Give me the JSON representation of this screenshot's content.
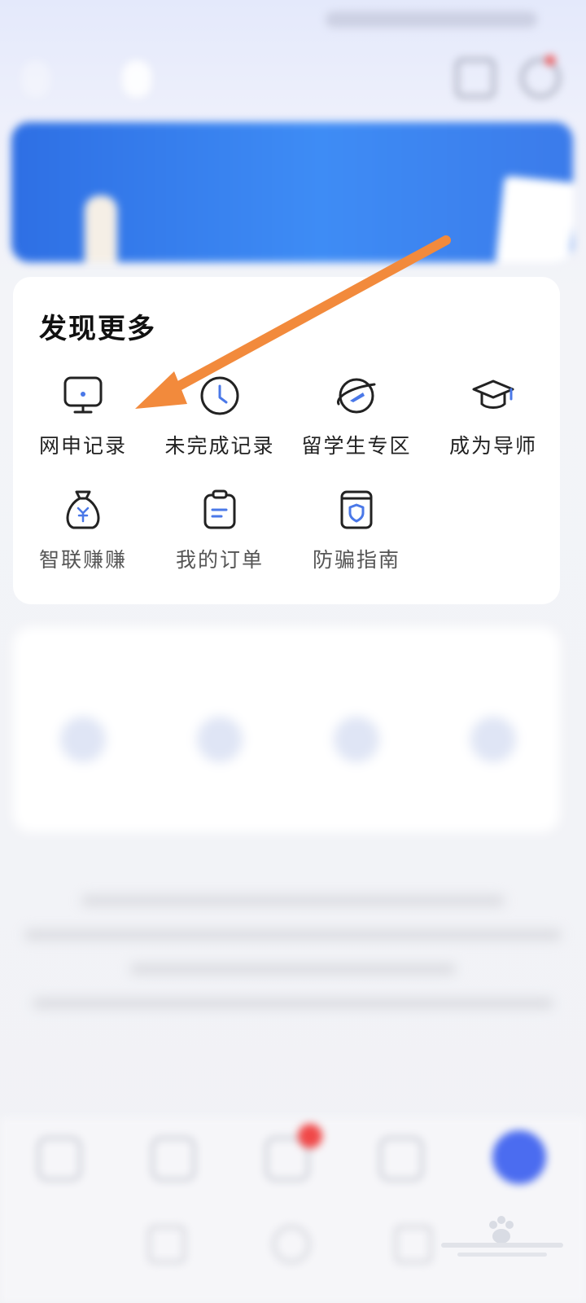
{
  "discover": {
    "title": "发现更多",
    "items": [
      {
        "label": "网申记录",
        "icon": "monitor-icon"
      },
      {
        "label": "未完成记录",
        "icon": "clock-icon"
      },
      {
        "label": "留学生专区",
        "icon": "globe-plane-icon"
      },
      {
        "label": "成为导师",
        "icon": "graduation-cap-icon"
      },
      {
        "label": "智联赚赚",
        "icon": "money-bag-icon"
      },
      {
        "label": "我的订单",
        "icon": "clipboard-icon"
      },
      {
        "label": "防骗指南",
        "icon": "shield-document-icon"
      }
    ]
  },
  "colors": {
    "icon_stroke": "#222222",
    "icon_accent": "#4a78e8",
    "arrow": "#f28a3c",
    "banner": "#2e6fe4"
  }
}
